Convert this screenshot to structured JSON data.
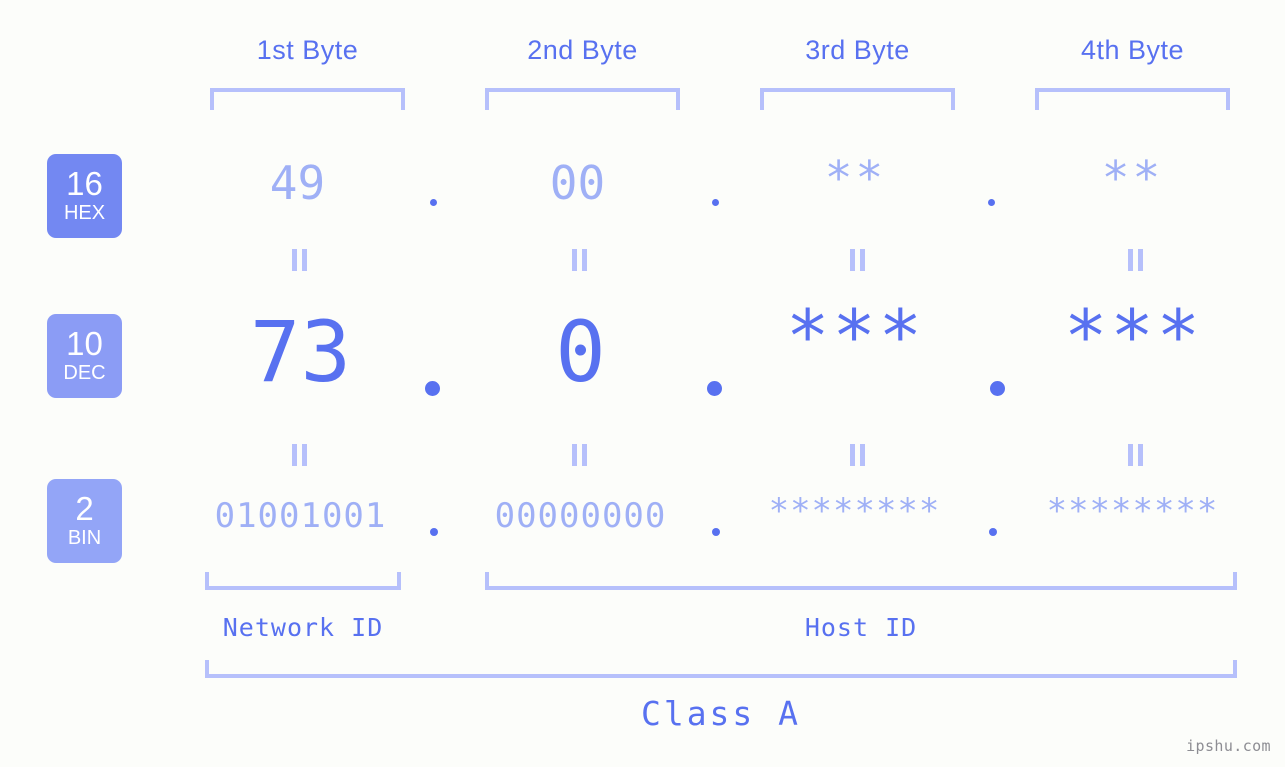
{
  "colors": {
    "background": "#fcfdfa",
    "accent_strong": "#5871f0",
    "accent_light": "#9fb0f6",
    "bracket": "#b6c0fb",
    "tag_hex_bg": "#7388f2",
    "tag_dec_bg": "#8b9cf5",
    "tag_bin_bg": "#93a5f7",
    "watermark": "#8d8d93"
  },
  "headers": [
    {
      "label": "1st Byte"
    },
    {
      "label": "2nd Byte"
    },
    {
      "label": "3rd Byte"
    },
    {
      "label": "4th Byte"
    }
  ],
  "bases": [
    {
      "number": "16",
      "abbr": "HEX"
    },
    {
      "number": "10",
      "abbr": "DEC"
    },
    {
      "number": "2",
      "abbr": "BIN"
    }
  ],
  "rows": {
    "hex": {
      "base": "16",
      "name": "HEX",
      "values": [
        "49",
        "00",
        "**",
        "**"
      ]
    },
    "dec": {
      "base": "10",
      "name": "DEC",
      "values": [
        "73",
        "0",
        "***",
        "***"
      ]
    },
    "bin": {
      "base": "2",
      "name": "BIN",
      "values": [
        "01001001",
        "00000000",
        "********",
        "********"
      ]
    }
  },
  "separator": ".",
  "equality_symbol": "=",
  "id_labels": {
    "network": "Network ID",
    "host": "Host ID"
  },
  "class_label": "Class A",
  "watermark": "ipshu.com"
}
